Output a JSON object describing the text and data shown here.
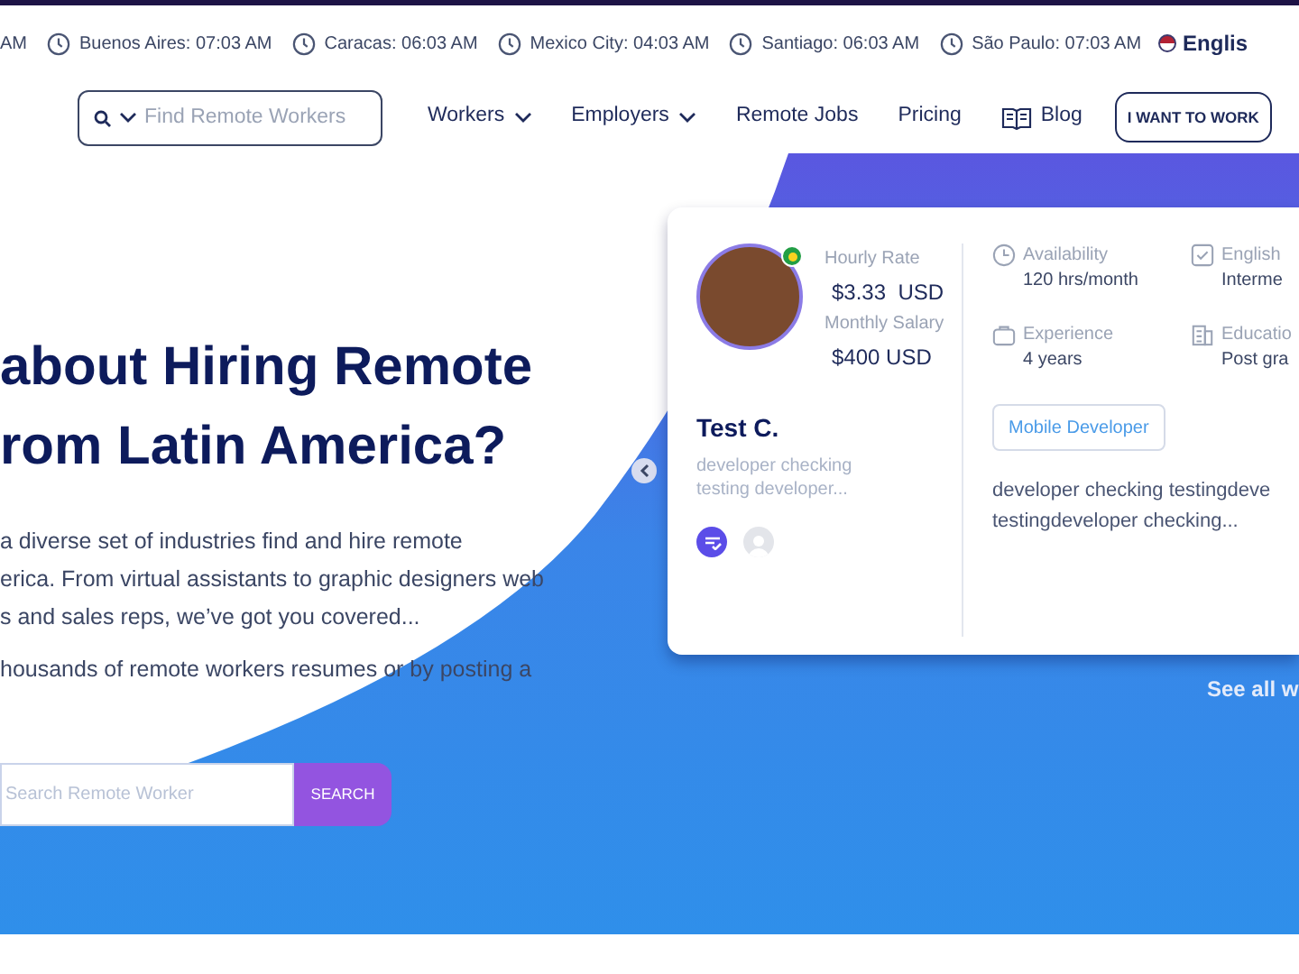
{
  "clock_bar": {
    "items": [
      {
        "text": "AM",
        "kind": "partial"
      },
      {
        "text": "Buenos Aires: 07:03 AM",
        "kind": "clock"
      },
      {
        "text": "Caracas: 06:03 AM",
        "kind": "clock"
      },
      {
        "text": "Mexico City: 04:03 AM",
        "kind": "clock"
      },
      {
        "text": "Santiago: 06:03 AM",
        "kind": "clock"
      },
      {
        "text": "São Paulo: 07:03 AM",
        "kind": "clock"
      }
    ],
    "language": "Englis"
  },
  "nav": {
    "search_placeholder": "Find Remote Workers",
    "links": [
      {
        "label": "Workers",
        "kind": "dropdown"
      },
      {
        "label": "Employers",
        "kind": "dropdown"
      },
      {
        "label": "Remote Jobs",
        "kind": "link"
      },
      {
        "label": "Pricing",
        "kind": "link"
      },
      {
        "label": "Blog",
        "kind": "book"
      }
    ],
    "cta": "I WANT TO WORK"
  },
  "hero": {
    "heading": [
      "about Hiring Remote",
      "rom Latin America?"
    ],
    "paragraphs": [
      [
        "a diverse set of industries find and hire remote",
        "erica. From virtual assistants to graphic designers web",
        "s and sales reps, we’ve got you covered..."
      ],
      [
        "housands of remote workers resumes or by posting a"
      ]
    ],
    "search": {
      "placeholder": "Search Remote Worker",
      "button": "SEARCH"
    }
  },
  "worker_card": {
    "hourly_rate_label": "Hourly Rate",
    "hourly_rate": "$3.33  USD",
    "monthly_label": "Monthly Salary",
    "monthly": "$400 USD",
    "name": "Test C.",
    "subtitle": "developer checking testing developer...",
    "stats": [
      {
        "label": "Availability",
        "value": "120 hrs/month",
        "kind": "clock"
      },
      {
        "label": "English",
        "value": "Interme",
        "kind": "check"
      },
      {
        "label": "Experience",
        "value": "4 years",
        "kind": "bag"
      },
      {
        "label": "Educatio",
        "value": "Post gra",
        "kind": "building"
      }
    ],
    "tag": "Mobile Developer",
    "description": "developer checking testingdeve testingdeveloper checking..."
  },
  "see_all": "See all w"
}
